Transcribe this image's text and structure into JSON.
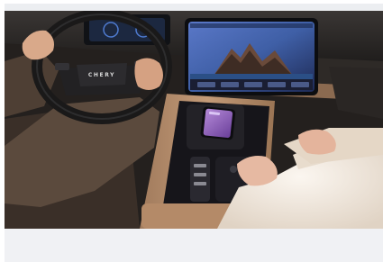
{
  "photo": {
    "steering_wheel_logo": "CHERY",
    "icons": {
      "wheel": "steering-wheel",
      "screen": "infotainment-screen",
      "phone": "smartphone-charging"
    }
  },
  "colors": {
    "interior_dark": "#2a2623",
    "console_tan": "#b88f6f",
    "screen_sky": "#3f5fa6",
    "sleeve": "#5b4a3d",
    "fur_coat": "#efe6dc"
  }
}
